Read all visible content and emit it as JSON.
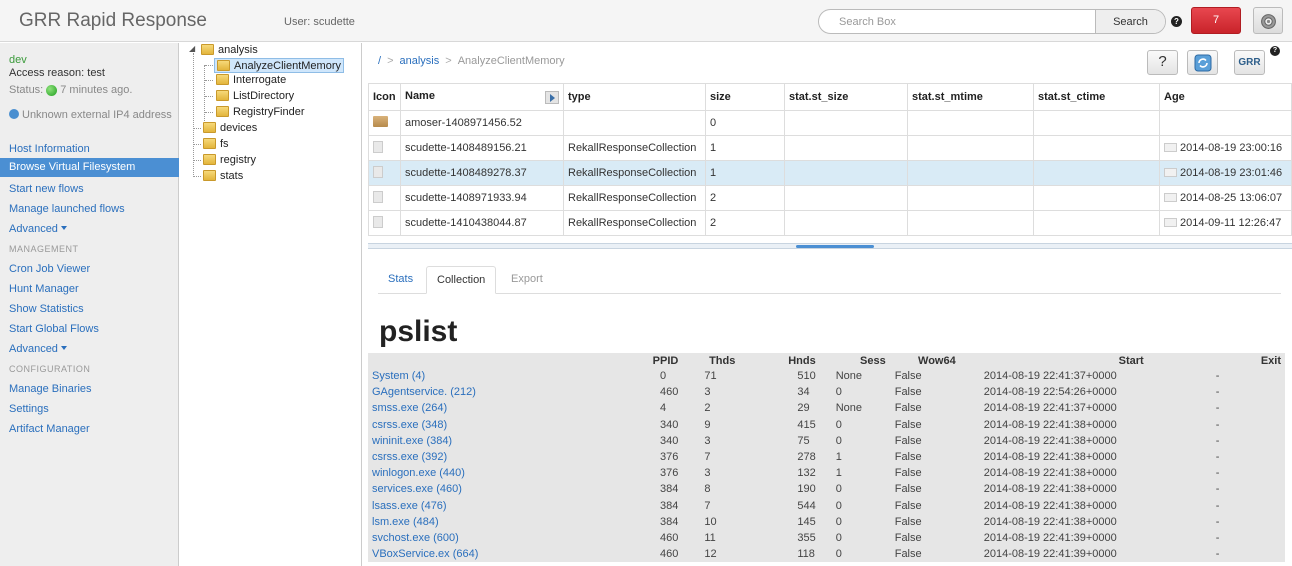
{
  "header": {
    "title": "GRR Rapid Response",
    "user": "User: scudette",
    "search_placeholder": "Search Box",
    "search_button": "Search",
    "help_badge": "?",
    "notifications": "7"
  },
  "nav": {
    "client_name": "dev",
    "access_reason": "Access reason: test",
    "status_prefix": "Status:",
    "status_time": "7 minutes ago.",
    "ip": "Unknown external IP4 address",
    "links_top": [
      "Host Information",
      "Browse Virtual Filesystem",
      "Start new flows",
      "Manage launched flows",
      "Advanced"
    ],
    "section_management": "MANAGEMENT",
    "links_management": [
      "Cron Job Viewer",
      "Hunt Manager",
      "Show Statistics",
      "Start Global Flows",
      "Advanced"
    ],
    "section_configuration": "CONFIGURATION",
    "links_configuration": [
      "Manage Binaries",
      "Settings",
      "Artifact Manager"
    ]
  },
  "tree": {
    "root": "analysis",
    "children": [
      "AnalyzeClientMemory",
      "Interrogate",
      "ListDirectory",
      "RegistryFinder"
    ],
    "others": [
      "devices",
      "fs",
      "registry",
      "stats"
    ]
  },
  "breadcrumb": {
    "root": "/",
    "parent": "analysis",
    "current": "AnalyzeClientMemory"
  },
  "toolbar": {
    "help": "?",
    "grr": "GRR",
    "badge": "?"
  },
  "file_table": {
    "columns": [
      "Icon",
      "Name",
      "type",
      "size",
      "stat.st_size",
      "stat.st_mtime",
      "stat.st_ctime",
      "Age"
    ],
    "rows": [
      {
        "name": "amoser-1408971456.52",
        "type": "",
        "size": "0",
        "age": ""
      },
      {
        "name": "scudette-1408489156.21",
        "type": "RekallResponseCollection",
        "size": "1",
        "age": "2014-08-19 23:00:16"
      },
      {
        "name": "scudette-1408489278.37",
        "type": "RekallResponseCollection",
        "size": "1",
        "age": "2014-08-19 23:01:46"
      },
      {
        "name": "scudette-1408971933.94",
        "type": "RekallResponseCollection",
        "size": "2",
        "age": "2014-08-25 13:06:07"
      },
      {
        "name": "scudette-1410438044.87",
        "type": "RekallResponseCollection",
        "size": "2",
        "age": "2014-09-11 12:26:47"
      }
    ]
  },
  "tabs": [
    "Stats",
    "Collection",
    "Export"
  ],
  "pslist": {
    "title": "pslist",
    "columns": [
      "",
      "PPID",
      "Thds",
      "Hnds",
      "Sess",
      "Wow64",
      "Start",
      "Exit"
    ],
    "rows": [
      [
        "System (4)",
        "0",
        "71",
        "510",
        "None",
        "False",
        "2014-08-19 22:41:37+0000",
        "-"
      ],
      [
        "GAgentservice. (212)",
        "460",
        "3",
        "34",
        "0",
        "False",
        "2014-08-19 22:54:26+0000",
        "-"
      ],
      [
        "smss.exe (264)",
        "4",
        "2",
        "29",
        "None",
        "False",
        "2014-08-19 22:41:37+0000",
        "-"
      ],
      [
        "csrss.exe (348)",
        "340",
        "9",
        "415",
        "0",
        "False",
        "2014-08-19 22:41:38+0000",
        "-"
      ],
      [
        "wininit.exe (384)",
        "340",
        "3",
        "75",
        "0",
        "False",
        "2014-08-19 22:41:38+0000",
        "-"
      ],
      [
        "csrss.exe (392)",
        "376",
        "7",
        "278",
        "1",
        "False",
        "2014-08-19 22:41:38+0000",
        "-"
      ],
      [
        "winlogon.exe (440)",
        "376",
        "3",
        "132",
        "1",
        "False",
        "2014-08-19 22:41:38+0000",
        "-"
      ],
      [
        "services.exe (460)",
        "384",
        "8",
        "190",
        "0",
        "False",
        "2014-08-19 22:41:38+0000",
        "-"
      ],
      [
        "lsass.exe (476)",
        "384",
        "7",
        "544",
        "0",
        "False",
        "2014-08-19 22:41:38+0000",
        "-"
      ],
      [
        "lsm.exe (484)",
        "384",
        "10",
        "145",
        "0",
        "False",
        "2014-08-19 22:41:38+0000",
        "-"
      ],
      [
        "svchost.exe (600)",
        "460",
        "11",
        "355",
        "0",
        "False",
        "2014-08-19 22:41:39+0000",
        "-"
      ],
      [
        "VBoxService.ex (664)",
        "460",
        "12",
        "118",
        "0",
        "False",
        "2014-08-19 22:41:39+0000",
        "-"
      ]
    ]
  },
  "colors": {
    "accent": "#4b8fd3",
    "link": "#2a6fbd",
    "alert": "#d9363e",
    "status_ok": "#2db52d"
  }
}
